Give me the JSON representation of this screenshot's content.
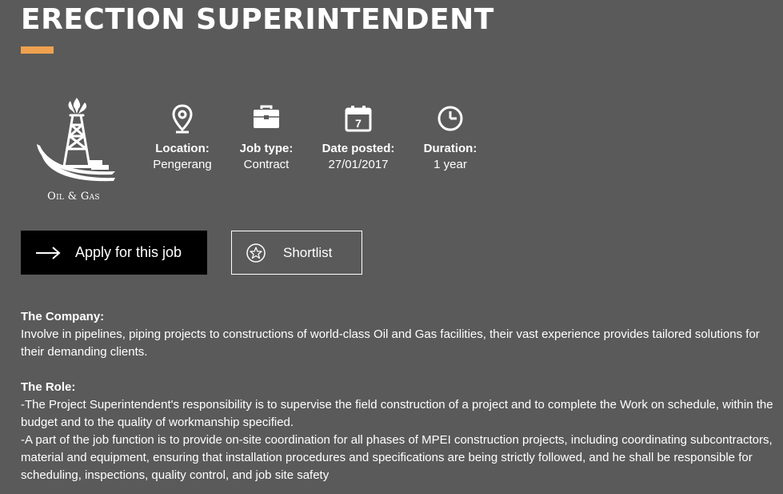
{
  "job": {
    "title": "ERECTION SUPERINTENDENT",
    "sector": "Oil & Gas",
    "accent_color": "#f0a150"
  },
  "meta": [
    {
      "icon": "location-pin-icon",
      "label": "Location:",
      "value": "Pengerang"
    },
    {
      "icon": "briefcase-icon",
      "label": "Job type:",
      "value": "Contract"
    },
    {
      "icon": "calendar-icon",
      "label": "Date posted:",
      "value": "27/01/2017"
    },
    {
      "icon": "clock-icon",
      "label": "Duration:",
      "value": "1 year"
    }
  ],
  "calendar_day": "7",
  "actions": {
    "apply_label": "Apply for this job",
    "shortlist_label": "Shortlist"
  },
  "description": {
    "company_heading": "The Company:",
    "company_text": "Involve in pipelines, piping projects to constructions of world-class Oil and Gas facilities, their vast experience provides tailored solutions for their demanding clients.",
    "role_heading": "The Role:",
    "role_line_1": "-The Project Superintendent's responsibility is to supervise the field construction of a project and to complete the Work on schedule, within the budget and to the quality of workmanship specified.",
    "role_line_2": "-A part of the job function is to provide on-site coordination for all phases of MPEI construction projects, including coordinating subcontractors, material and equipment, ensuring that installation procedures and specifications are being strictly followed, and he shall be responsible for scheduling, inspections, quality control, and job site safety"
  }
}
